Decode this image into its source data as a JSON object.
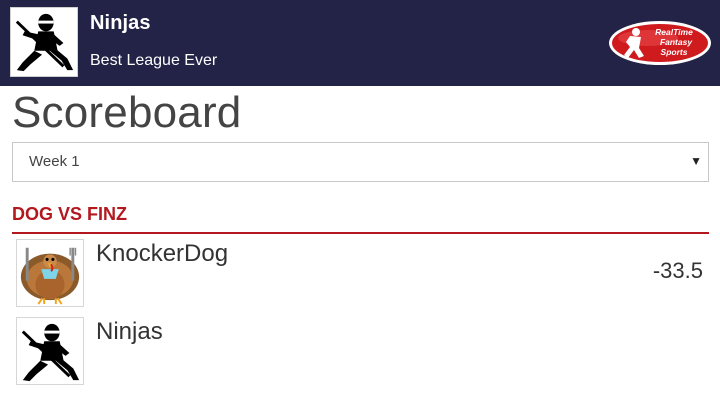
{
  "header": {
    "league_name": "Ninjas",
    "league_subtitle": "Best League Ever",
    "team_logo_icon": "ninja-icon",
    "brand_logo": {
      "line1": "RealTime",
      "line2": "Fantasy",
      "line3": "Sports",
      "icon": "football-player-icon"
    }
  },
  "page": {
    "title": "Scoreboard"
  },
  "week_select": {
    "value": "Week 1",
    "arrow": "▼"
  },
  "matchup": {
    "title": "DOG VS FINZ",
    "teams": [
      {
        "name": "KnockerDog",
        "score": "-33.5",
        "avatar_icon": "turkey-icon"
      },
      {
        "name": "Ninjas",
        "score": "",
        "avatar_icon": "ninja-icon"
      }
    ]
  },
  "colors": {
    "header_bg": "#232347",
    "accent_red": "#b3181f",
    "text": "#333333",
    "border": "#c8c8c8"
  }
}
